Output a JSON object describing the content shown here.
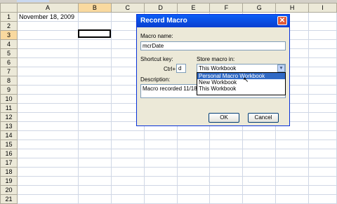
{
  "sheet": {
    "columns": [
      "A",
      "B",
      "C",
      "D",
      "E",
      "F",
      "G",
      "H",
      "I"
    ],
    "selected_column": "B",
    "rows": [
      "1",
      "2",
      "3",
      "4",
      "5",
      "6",
      "7",
      "8",
      "9",
      "10",
      "11",
      "12",
      "13",
      "14",
      "15",
      "16",
      "17",
      "18",
      "19",
      "20",
      "21"
    ],
    "selected_row": "3",
    "cell_a1": "November 18, 2009"
  },
  "dialog": {
    "title": "Record Macro",
    "macro_name_label": "Macro name:",
    "macro_name_value": "mcrDate",
    "shortcut_label": "Shortcut key:",
    "ctrl_label": "Ctrl+",
    "shortcut_value": "d",
    "store_label": "Store macro in:",
    "store_value": "This Workbook",
    "store_options": [
      "Personal Macro Workbook",
      "New Workbook",
      "This Workbook"
    ],
    "highlighted_option": "Personal Macro Workbook",
    "description_label": "Description:",
    "description_value": "Macro recorded 11/18",
    "ok_label": "OK",
    "cancel_label": "Cancel"
  },
  "icons": {
    "close": "close-icon",
    "dropdown": "chevron-down-icon",
    "cursor": "mouse-pointer-icon"
  },
  "colors": {
    "title_bar": "#0a5ef5",
    "selection": "#316ac5",
    "header_selected": "#f9d99f"
  }
}
